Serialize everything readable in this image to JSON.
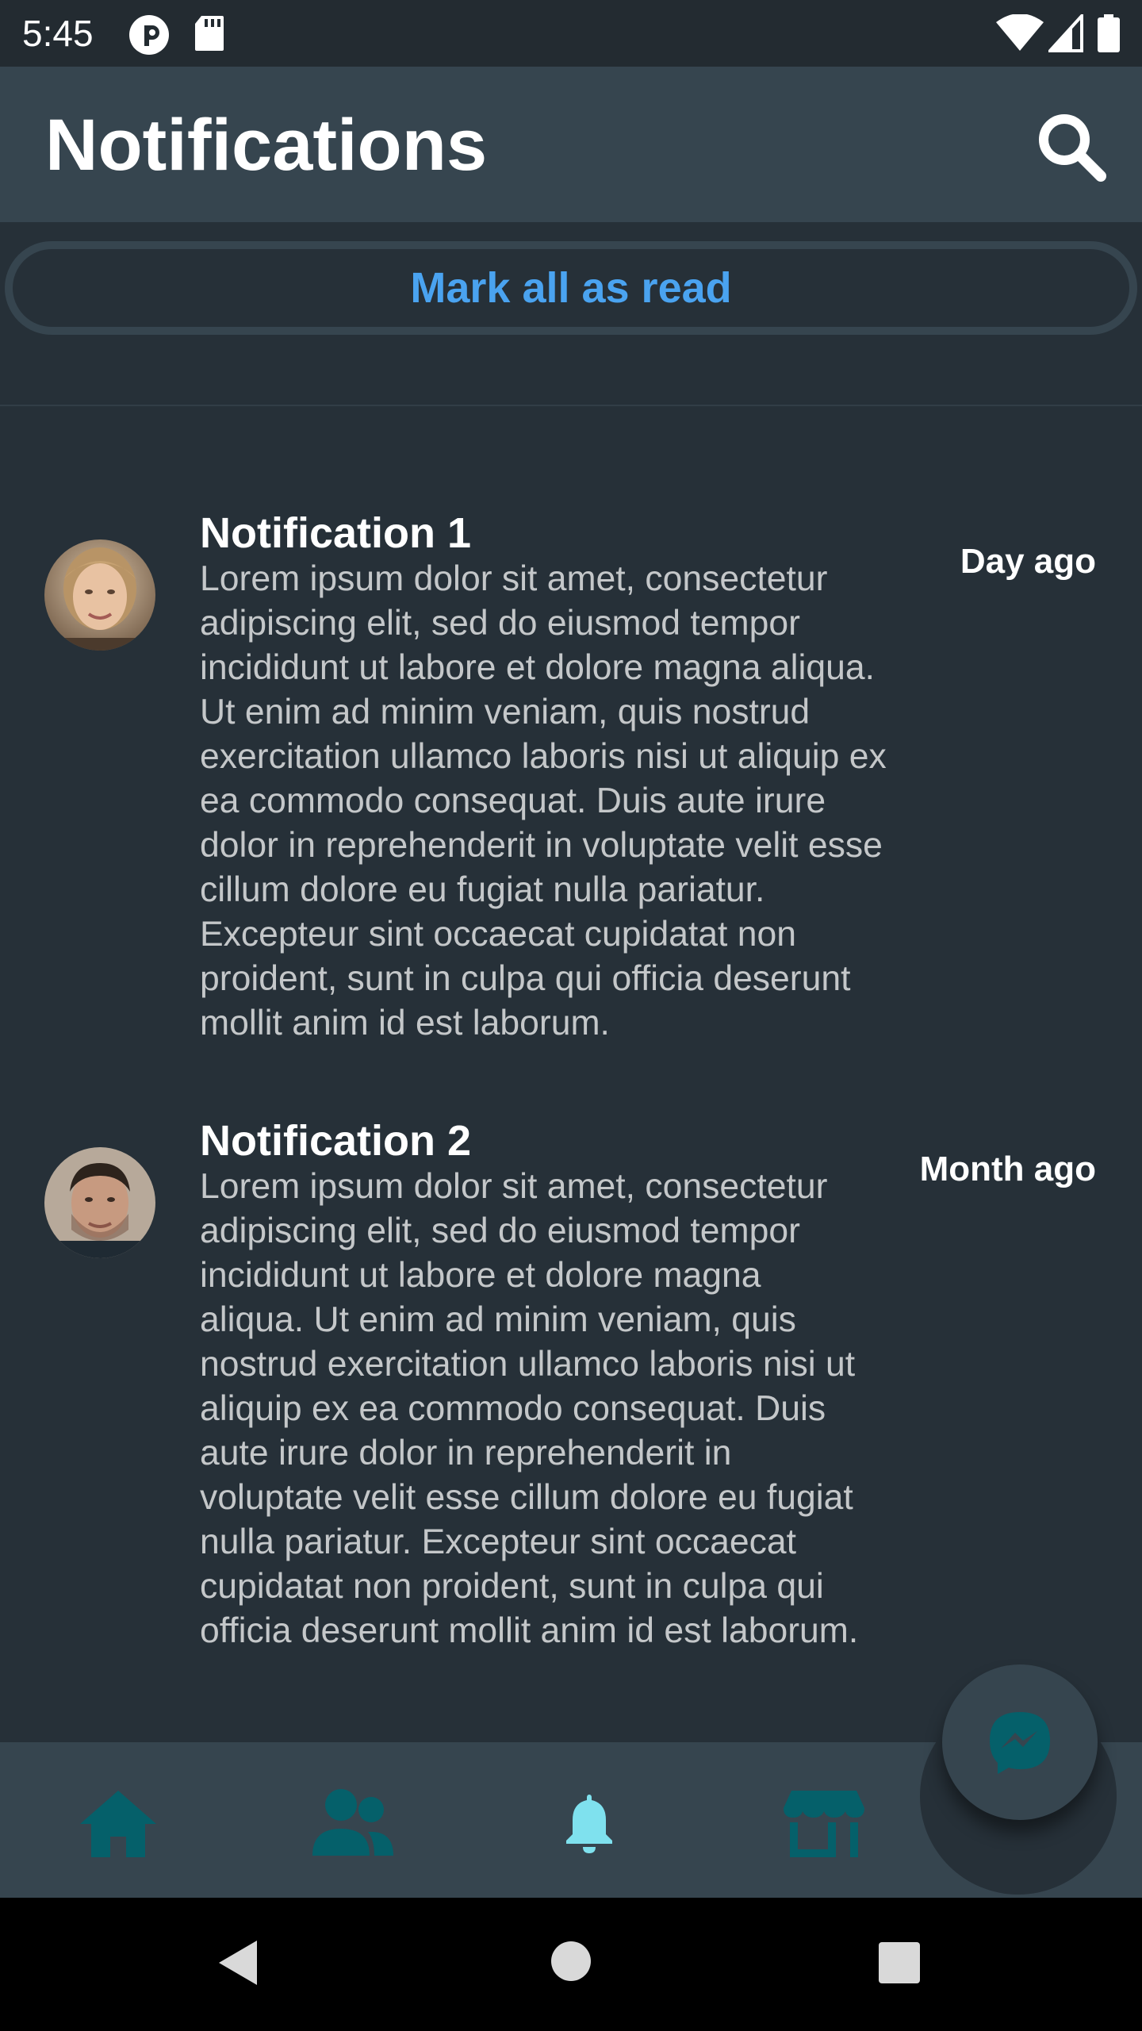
{
  "status_bar": {
    "time": "5:45",
    "left_icons": [
      "pocket-casts-icon",
      "sd-card-icon"
    ],
    "right_icons": [
      "wifi-icon",
      "cell-signal-icon",
      "battery-icon"
    ]
  },
  "app_bar": {
    "title": "Notifications",
    "search_icon": "search-icon"
  },
  "mark_all_read": {
    "label": "Mark all as read"
  },
  "notifications": [
    {
      "title": "Notification 1",
      "body": "Lorem ipsum dolor sit amet, consectetur adipiscing elit, sed do eiusmod tempor incididunt ut labore et dolore magna aliqua. Ut enim ad minim veniam, quis nostrud exercitation ullamco laboris nisi ut aliquip ex ea commodo consequat. Duis aute irure dolor in reprehenderit in voluptate velit esse cillum dolore eu fugiat nulla pariatur. Excepteur sint occaecat cupidatat non proident, sunt in culpa qui officia deserunt mollit anim id est laborum.",
      "time": "Day ago"
    },
    {
      "title": "Notification 2",
      "body": "Lorem ipsum dolor sit amet, consectetur adipiscing elit, sed do eiusmod tempor incididunt ut labore et dolore magna aliqua. Ut enim ad minim veniam, quis nostrud exercitation ullamco laboris nisi ut aliquip ex ea commodo consequat. Duis aute irure dolor in reprehenderit in voluptate velit esse cillum dolore eu fugiat nulla pariatur. Excepteur sint occaecat cupidatat non proident, sunt in culpa qui officia deserunt mollit anim id est laborum.",
      "time": "Month ago"
    }
  ],
  "bottom_nav": {
    "items": [
      {
        "icon": "home-icon",
        "active": false
      },
      {
        "icon": "friends-icon",
        "active": false
      },
      {
        "icon": "bell-icon",
        "active": true
      },
      {
        "icon": "store-icon",
        "active": false
      }
    ],
    "fab_icon": "messenger-icon"
  },
  "system_nav": [
    "back-icon",
    "home-circle-icon",
    "recents-icon"
  ],
  "colors": {
    "background": "#263038",
    "app_bar": "#36454f",
    "accent_blue": "#4aa3f0",
    "nav_inactive": "#05606a",
    "nav_active": "#7fe1ee"
  }
}
